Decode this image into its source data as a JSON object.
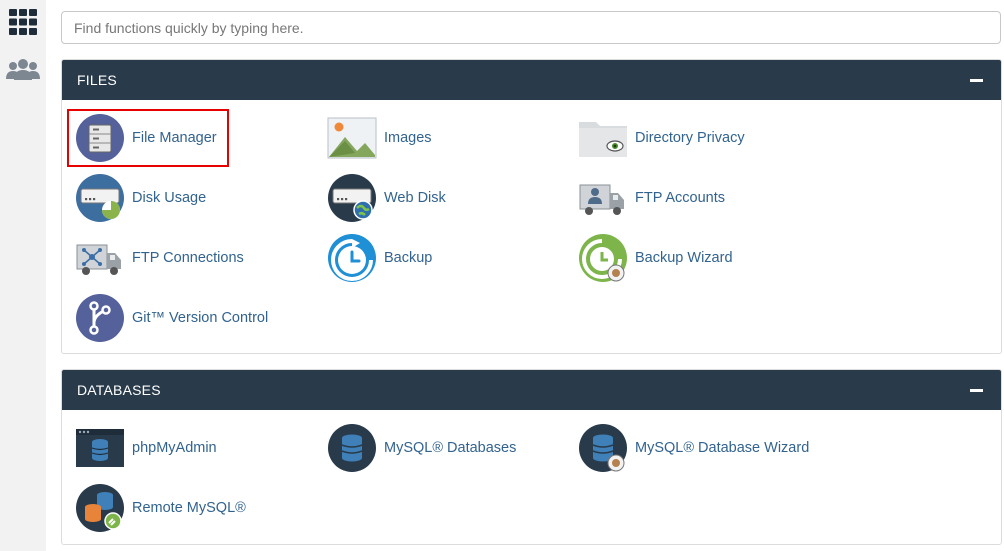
{
  "search": {
    "placeholder": "Find functions quickly by typing here."
  },
  "sidebar": {
    "items": [
      {
        "icon": "grid-icon"
      },
      {
        "icon": "users-icon"
      }
    ]
  },
  "files": {
    "title": "FILES",
    "items": [
      {
        "label": "File Manager",
        "icon": "file-manager-icon"
      },
      {
        "label": "Images",
        "icon": "images-icon"
      },
      {
        "label": "Directory Privacy",
        "icon": "directory-privacy-icon"
      },
      {
        "label": "Disk Usage",
        "icon": "disk-usage-icon"
      },
      {
        "label": "Web Disk",
        "icon": "web-disk-icon"
      },
      {
        "label": "FTP Accounts",
        "icon": "ftp-accounts-icon"
      },
      {
        "label": "FTP Connections",
        "icon": "ftp-connections-icon"
      },
      {
        "label": "Backup",
        "icon": "backup-icon"
      },
      {
        "label": "Backup Wizard",
        "icon": "backup-wizard-icon"
      },
      {
        "label": "Git™ Version Control",
        "icon": "git-icon"
      }
    ]
  },
  "databases": {
    "title": "DATABASES",
    "items": [
      {
        "label": "phpMyAdmin",
        "icon": "phpmyadmin-icon"
      },
      {
        "label": "MySQL® Databases",
        "icon": "mysql-databases-icon"
      },
      {
        "label": "MySQL® Database Wizard",
        "icon": "mysql-wizard-icon"
      },
      {
        "label": "Remote MySQL®",
        "icon": "remote-mysql-icon"
      }
    ]
  },
  "colors": {
    "header_bg": "#293a4a",
    "link": "#32638f",
    "highlight": "#e60000"
  }
}
